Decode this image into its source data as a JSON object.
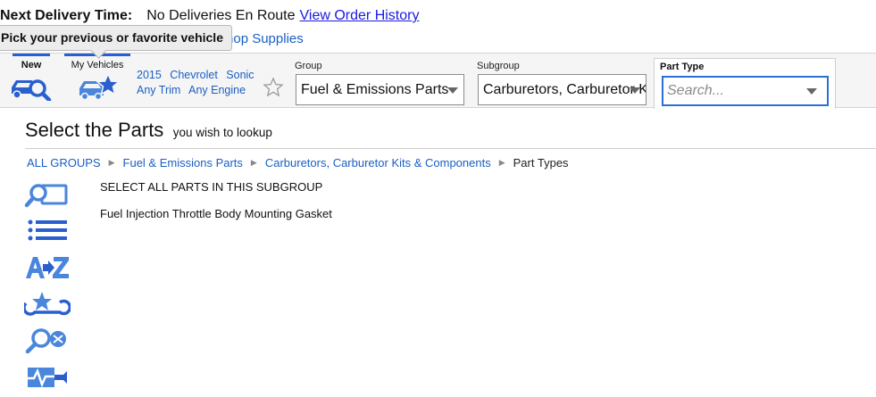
{
  "delivery": {
    "label": "Next Delivery Time:",
    "value": "No Deliveries En Route",
    "link": "View Order History"
  },
  "shop_supplies": "Shop Supplies",
  "tooltip": "Pick your previous or favorite vehicle",
  "toolbar": {
    "new_label": "New",
    "my_vehicles_label": "My Vehicles",
    "vehicle": {
      "year": "2015",
      "make": "Chevrolet",
      "model": "Sonic",
      "trim": "Any Trim",
      "engine": "Any Engine"
    },
    "group": {
      "label": "Group",
      "value": "Fuel & Emissions Parts"
    },
    "subgroup": {
      "label": "Subgroup",
      "value": "Carburetors, Carburetor Kits & Components"
    },
    "part_type": {
      "label": "Part Type",
      "placeholder": "Search..."
    }
  },
  "heading": {
    "title": "Select the Parts",
    "subtitle": "you wish to lookup"
  },
  "breadcrumb": {
    "items": [
      "ALL GROUPS",
      "Fuel & Emissions Parts",
      "Carburetors, Carburetor Kits & Components"
    ],
    "current": "Part Types"
  },
  "side_icons": [
    "lookup-icon",
    "list-icon",
    "a-to-z-icon",
    "favorites-tools-icon",
    "search-parts-icon",
    "diagnostics-icon"
  ],
  "parts": [
    "SELECT ALL PARTS IN THIS SUBGROUP",
    "Fuel Injection Throttle Body Mounting Gasket"
  ],
  "colors": {
    "link": "#1a5fc4",
    "icon_blue": "#4a86dc",
    "toolbar_bg": "#f5f5f5",
    "focus_border": "#2a6fd4"
  }
}
